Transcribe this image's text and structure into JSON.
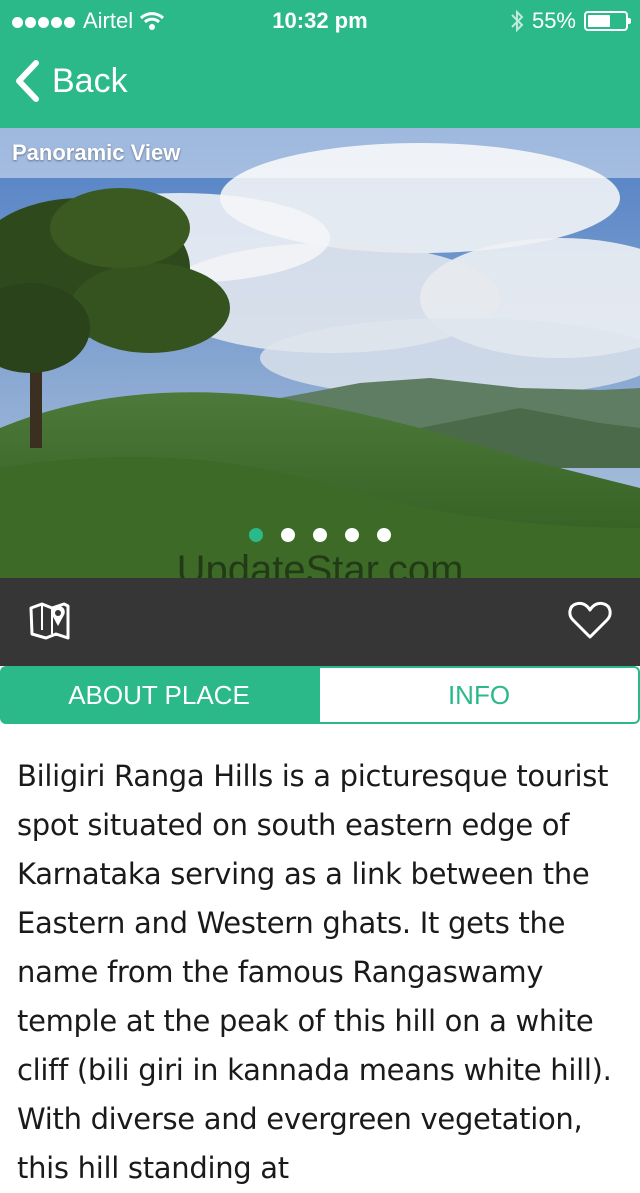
{
  "status_bar": {
    "carrier": "Airtel",
    "time": "10:32 pm",
    "battery": "55%",
    "icons": [
      "signal-dots-icon",
      "wifi-icon",
      "bluetooth-icon",
      "battery-icon"
    ]
  },
  "nav": {
    "back_label": "Back"
  },
  "hero": {
    "caption": "Panoramic View",
    "pager_count": 5,
    "pager_active": 1,
    "watermark": "UpdateStar.com"
  },
  "actions": {
    "icons": [
      "map-icon",
      "heart-icon"
    ]
  },
  "tabs": [
    {
      "label": "ABOUT PLACE",
      "active": true
    },
    {
      "label": "INFO",
      "active": false
    }
  ],
  "about": {
    "text": "Biligiri Ranga Hills is a picturesque tourist spot situated on south eastern edge of Karnataka serving as a link between the Eastern and Western ghats. It gets the name from the famous Rangaswamy temple at the peak of this hill on a white cliff (bili giri in kannada means white hill). With diverse and evergreen vegetation, this hill standing at"
  },
  "colors": {
    "accent": "#2bb98a",
    "action_bar": "#363636"
  }
}
